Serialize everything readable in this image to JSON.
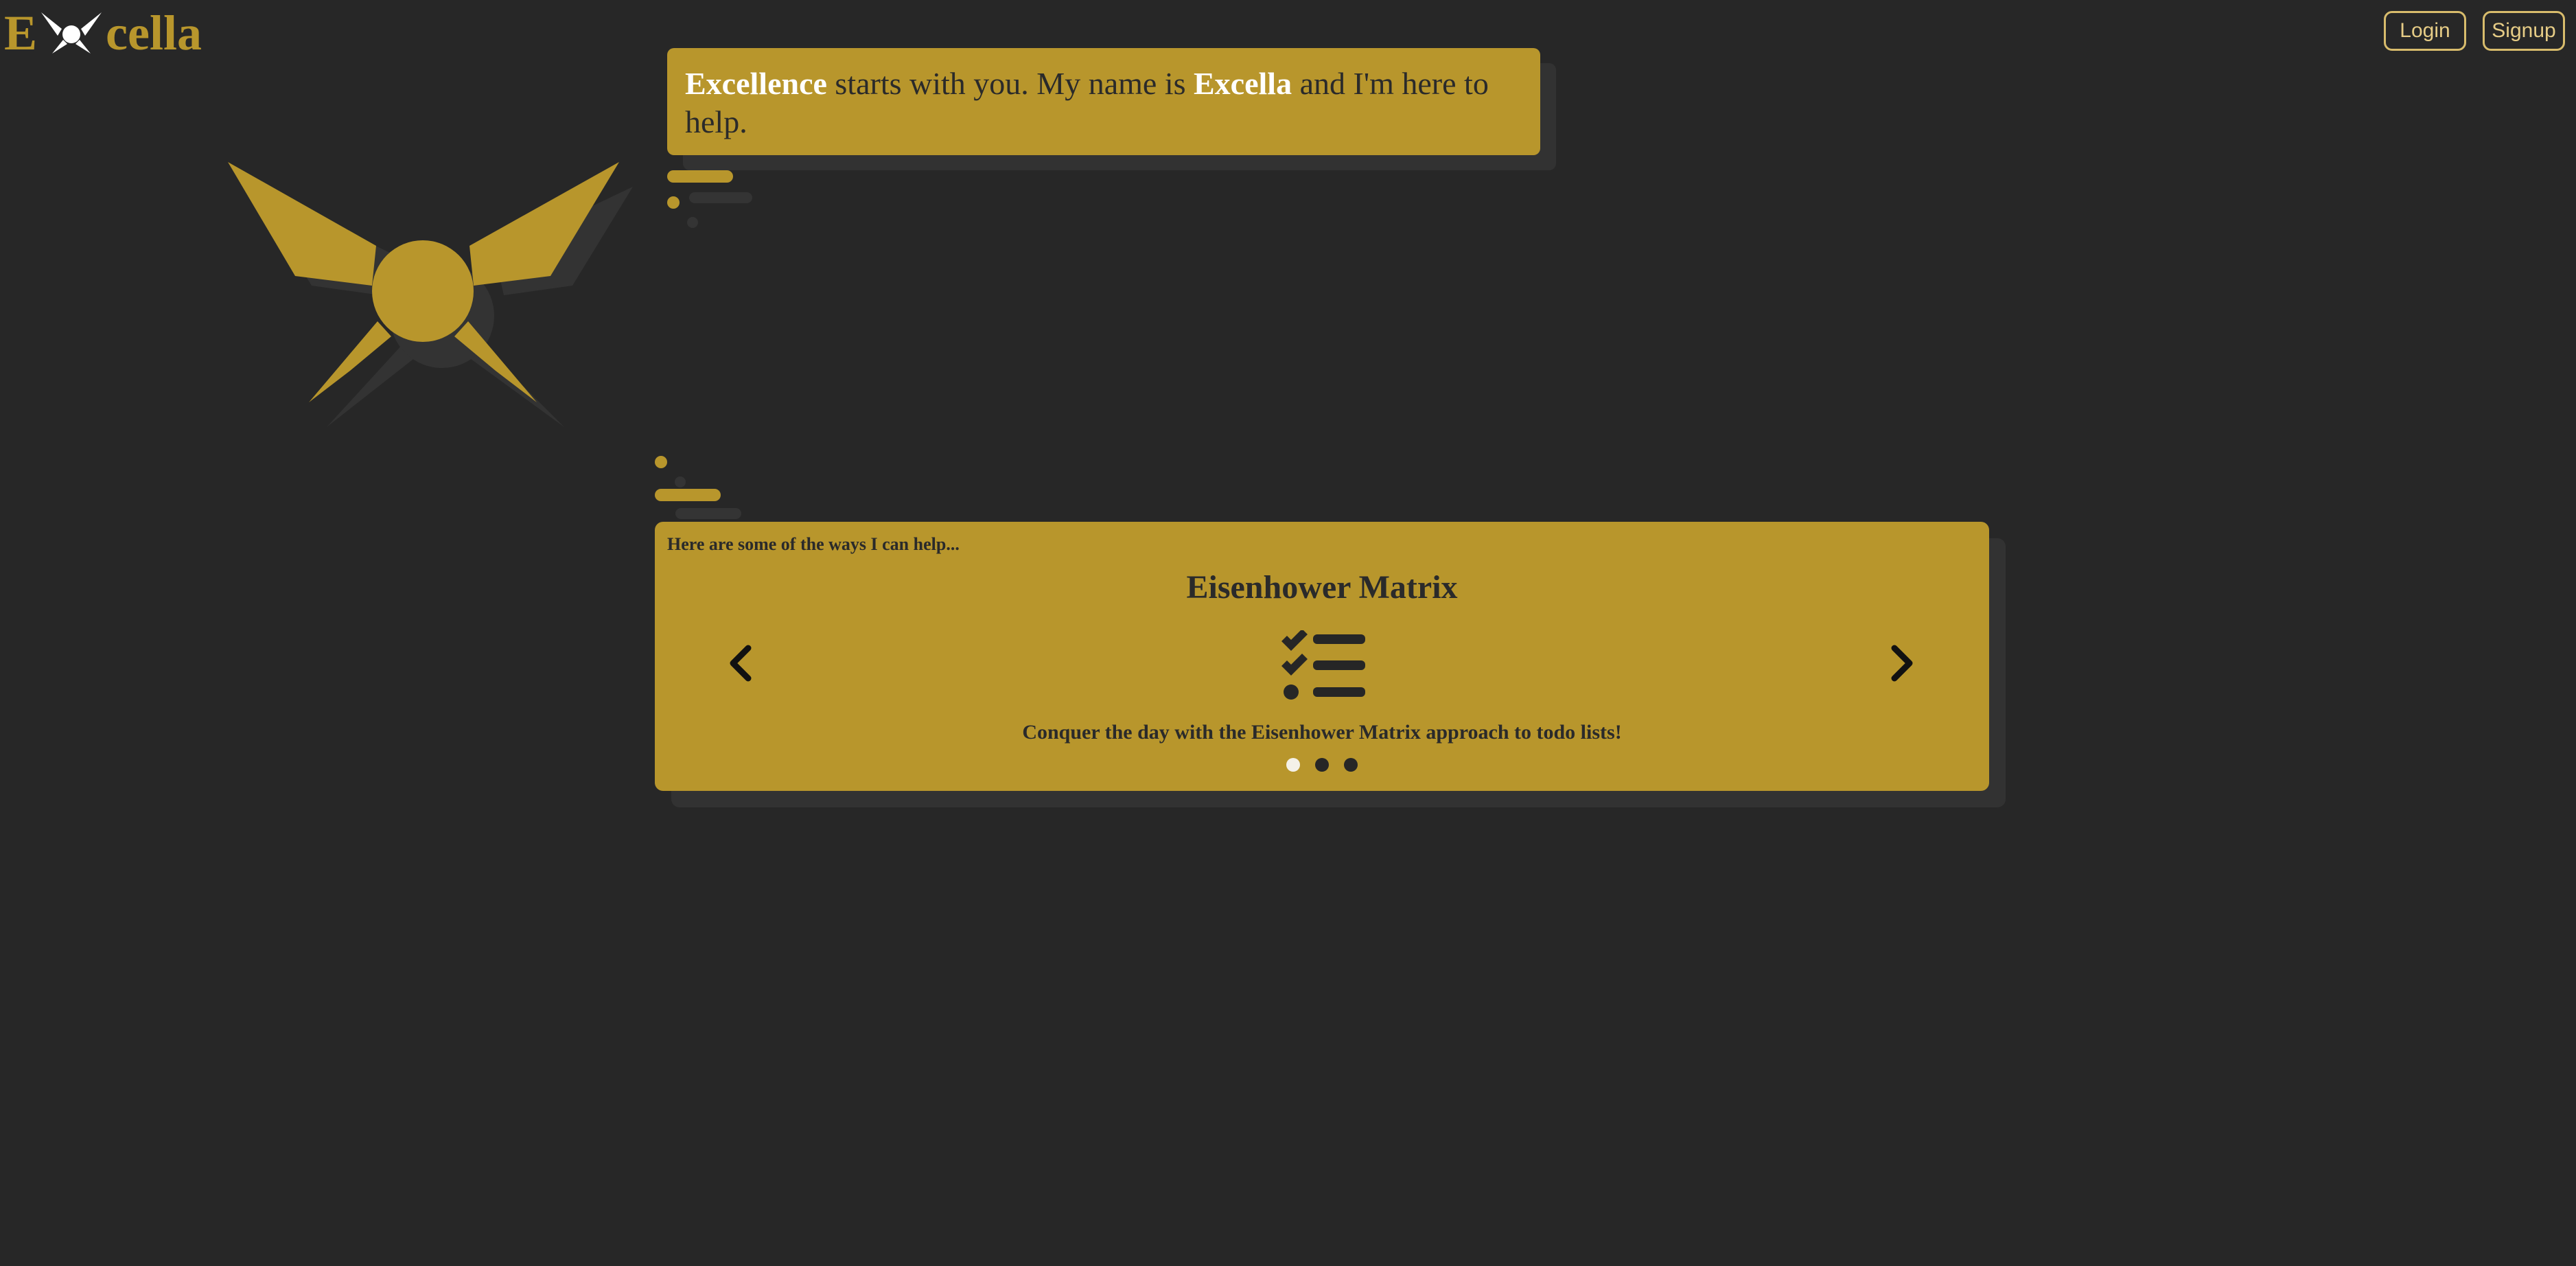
{
  "brand": {
    "logo_left": "E",
    "logo_right": "cella",
    "logo_icon": "bowtie-logo-icon",
    "color": "#b8962c"
  },
  "header": {
    "login_label": "Login",
    "signup_label": "Signup"
  },
  "colors": {
    "background": "#272727",
    "accent": "#b8962c",
    "shadow": "#323232",
    "text_dark": "#2a2a2a",
    "highlight": "#ffffff"
  },
  "greeting": {
    "strong_1": "Excellence",
    "text_1": " starts with you. My name is ",
    "strong_2": "Excella",
    "text_2": " and I'm here to help."
  },
  "carousel": {
    "intro": "Here are some of the ways I can help...",
    "current_index": 0,
    "slide_count": 3,
    "slides": [
      {
        "title": "Eisenhower Matrix",
        "icon": "tasks-checklist-icon",
        "description": "Conquer the day with the Eisenhower Matrix approach to todo lists!"
      }
    ],
    "prev_icon": "chevron-left-icon",
    "next_icon": "chevron-right-icon"
  }
}
